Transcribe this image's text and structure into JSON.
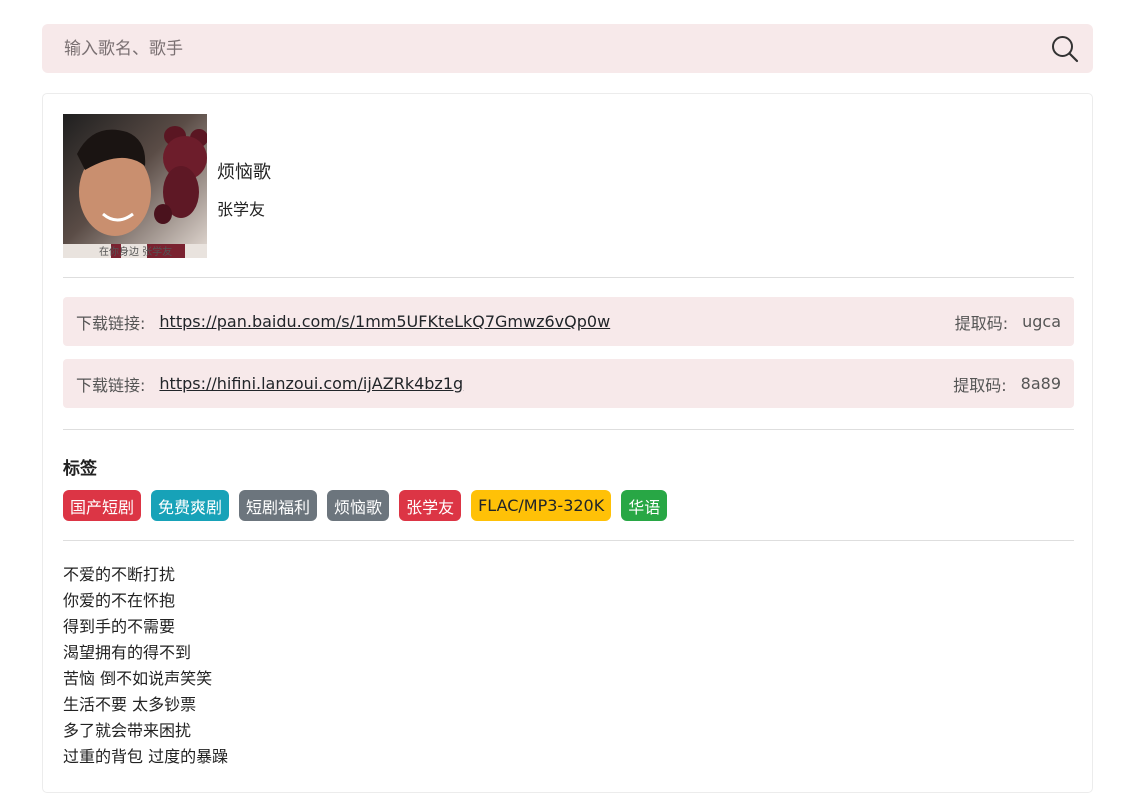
{
  "search": {
    "placeholder": "输入歌名、歌手",
    "icon": "search-icon"
  },
  "song": {
    "title": "烦恼歌",
    "artist": "张学友",
    "cover_caption": "在你身边 张学友"
  },
  "downloads": [
    {
      "label": "下载链接:",
      "url": "https://pan.baidu.com/s/1mm5UFKteLkQ7Gmwz6vQp0w",
      "code_label": "提取码:",
      "code": "ugca"
    },
    {
      "label": "下载链接:",
      "url": "https://hifini.lanzoui.com/ijAZRk4bz1g",
      "code_label": "提取码:",
      "code": "8a89"
    }
  ],
  "tags": {
    "heading": "标签",
    "items": [
      {
        "label": "国产短剧",
        "color": "#dc3545"
      },
      {
        "label": "免费爽剧",
        "color": "#17a2b8"
      },
      {
        "label": "短剧福利",
        "color": "#6c757d"
      },
      {
        "label": "烦恼歌",
        "color": "#6c757d"
      },
      {
        "label": "张学友",
        "color": "#dc3545"
      },
      {
        "label": "FLAC/MP3-320K",
        "color": "#ffc107",
        "text_color": "#212529"
      },
      {
        "label": "华语",
        "color": "#28a745"
      }
    ]
  },
  "lyrics": [
    "不爱的不断打扰",
    "你爱的不在怀抱",
    "得到手的不需要",
    "渴望拥有的得不到",
    "苦恼 倒不如说声笑笑",
    "生活不要 太多钞票",
    "多了就会带来困扰",
    "过重的背包 过度的暴躁"
  ]
}
